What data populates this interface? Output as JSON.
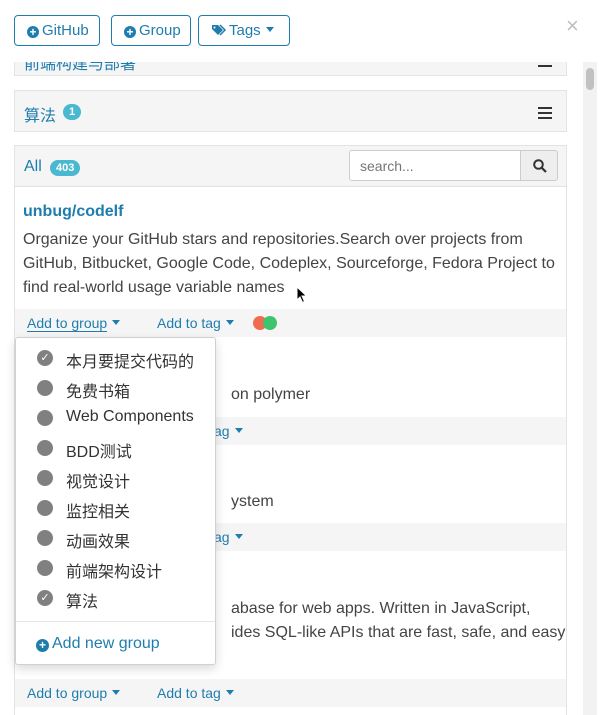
{
  "toolbar": {
    "github_label": "GitHub",
    "group_label": "Group",
    "tags_label": "Tags",
    "close_symbol": "×"
  },
  "top_panel": {
    "label": "前端构建与部署"
  },
  "algo_panel": {
    "label": "算法",
    "count": "1"
  },
  "all_panel": {
    "label": "All",
    "count": "403",
    "search_placeholder": "search..."
  },
  "repo1": {
    "title": "unbug/codelf",
    "description": "Organize your GitHub stars and repositories.Search over projects from GitHub, Bitbucket, Google Code, Codeplex, Sourceforge, Fedora Project to find real-world usage variable names",
    "tag_colors": [
      "#f26b4f",
      "#3ec46d"
    ]
  },
  "repo2": {
    "description_fragment": "on polymer"
  },
  "repo3": {
    "description_fragment": "ystem"
  },
  "repo4": {
    "description_line1": "abase for web apps. Written in JavaScript,",
    "description_line2": "ides SQL-like APIs that are fast, safe, and easy"
  },
  "actions": {
    "add_to_group": "Add to group",
    "add_to_tag": "Add to tag",
    "tag_fragment": "ag"
  },
  "group_dropdown": {
    "items": [
      {
        "label": "本月要提交代码的",
        "checked": true
      },
      {
        "label": "免费书箱",
        "checked": false
      },
      {
        "label": "Web Components",
        "checked": false
      },
      {
        "label": "BDD测试",
        "checked": false
      },
      {
        "label": "视觉设计",
        "checked": false
      },
      {
        "label": "监控相关",
        "checked": false
      },
      {
        "label": "动画效果",
        "checked": false
      },
      {
        "label": "前端架构设计",
        "checked": false
      },
      {
        "label": "算法",
        "checked": true
      }
    ],
    "add_new_label": "Add new group"
  },
  "colors": {
    "accent": "#1f7dae",
    "badge": "#4ab8d0",
    "check_gray": "#808080"
  }
}
